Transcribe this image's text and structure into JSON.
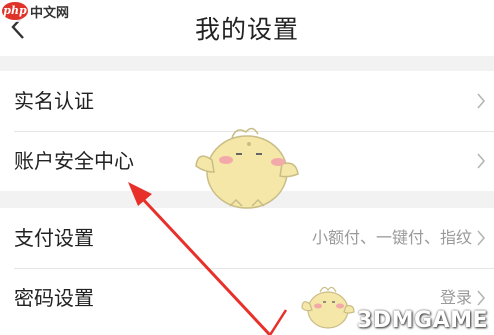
{
  "watermark_top": {
    "logo_text": "php",
    "site_text": "中文网"
  },
  "header": {
    "title": "我的设置",
    "back_icon": "chevron-left-icon"
  },
  "settings": {
    "group1": [
      {
        "label": "实名认证",
        "value": ""
      },
      {
        "label": "账户安全中心",
        "value": ""
      }
    ],
    "group2": [
      {
        "label": "支付设置",
        "value": "小额付、一键付、指纹"
      },
      {
        "label": "密码设置",
        "value": "登录"
      }
    ]
  },
  "annotation": {
    "arrow_color": "#e8302a"
  },
  "watermark_bottom": {
    "brand": "3DMGAME"
  }
}
